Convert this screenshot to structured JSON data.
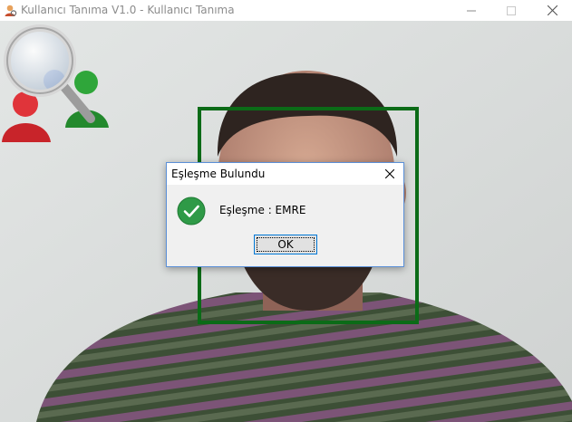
{
  "window": {
    "title": "Kullanıcı Tanıma V1.0 - Kullanıcı Tanıma",
    "buttons": {
      "minimize": "minimize-icon",
      "maximize": "maximize-icon",
      "close": "close-icon"
    }
  },
  "camera": {
    "face_box_color": "#0b6b17"
  },
  "dialog": {
    "title": "Eşleşme Bulundu",
    "message": "Eşleşme :  EMRE",
    "ok_label": "OK",
    "icon": "success-check-icon",
    "accent": "#0078d7"
  }
}
